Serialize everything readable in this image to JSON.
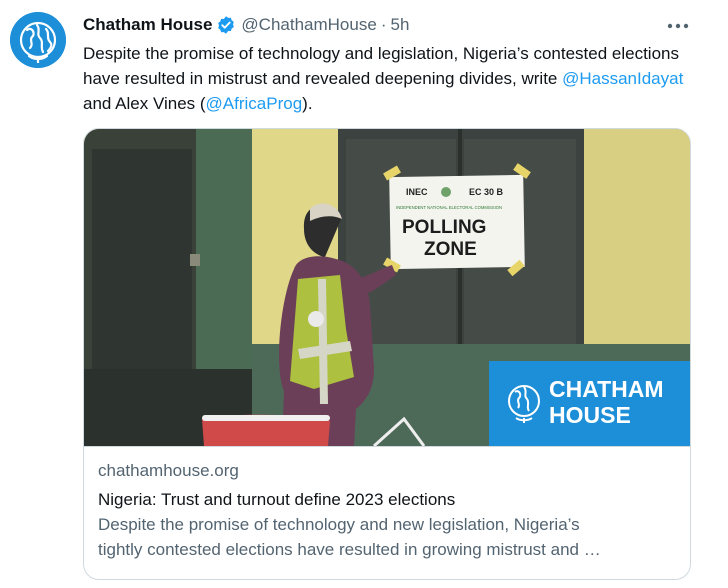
{
  "account": {
    "name": "Chatham House",
    "handle": "@ChathamHouse",
    "separator": "·",
    "time": "5h"
  },
  "tweet": {
    "text_part1": "Despite the promise of technology and legislation, Nigeria’s contested elections have resulted in mistrust and revealed deepening divides, write ",
    "mention1": "@HassanIdayat",
    "text_part2": " and Alex Vines (",
    "mention2": "@AfricaProg",
    "text_part3": ")."
  },
  "card": {
    "domain": "chathamhouse.org",
    "title": "Nigeria: Trust and turnout define 2023 elections",
    "description_line1": "Despite the promise of technology and new legislation, Nigeria’s",
    "description_line2": "tightly contested elections have resulted in growing mistrust and …",
    "image": {
      "poster_top_left": "INEC",
      "poster_top_right": "EC 30 B",
      "poster_small": "INDEPENDENT NATIONAL ELECTORAL COMMISSION",
      "poster_main_line1": "POLLING",
      "poster_main_line2": "ZONE",
      "logo_line1": "CHATHAM",
      "logo_line2": "HOUSE"
    }
  },
  "colors": {
    "brand_blue": "#1d8fd8",
    "link": "#1d9bf0",
    "secondary_text": "#536471",
    "border": "#cfd9de"
  },
  "icons": [
    "avatar-globe-icon",
    "verified-badge-icon",
    "more-options-icon",
    "chatham-house-logo-icon"
  ]
}
